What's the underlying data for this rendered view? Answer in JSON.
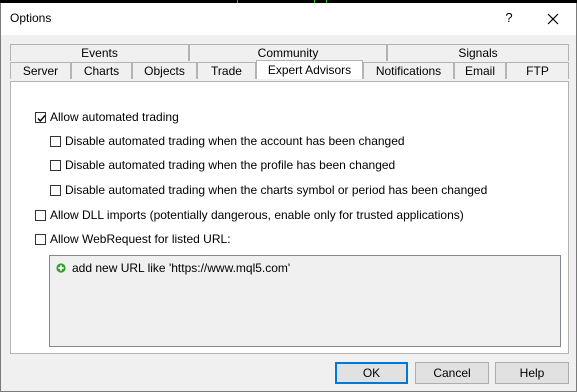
{
  "window": {
    "title": "Options",
    "help_label": "?"
  },
  "tabs_row1": [
    {
      "label": "Events"
    },
    {
      "label": "Community"
    },
    {
      "label": "Signals"
    }
  ],
  "tabs_row2": [
    {
      "label": "Server"
    },
    {
      "label": "Charts"
    },
    {
      "label": "Objects"
    },
    {
      "label": "Trade"
    },
    {
      "label": "Expert Advisors",
      "active": true
    },
    {
      "label": "Notifications"
    },
    {
      "label": "Email"
    },
    {
      "label": "FTP"
    }
  ],
  "options": {
    "allow_automated_trading": {
      "label": "Allow automated trading",
      "checked": true
    },
    "disable_on_account_change": {
      "label": "Disable automated trading when the account has been changed",
      "checked": false
    },
    "disable_on_profile_change": {
      "label": "Disable automated trading when the profile has been changed",
      "checked": false
    },
    "disable_on_symbol_change": {
      "label": "Disable automated trading when the charts symbol or period has been changed",
      "checked": false
    },
    "allow_dll_imports": {
      "label": "Allow DLL imports (potentially dangerous, enable only for trusted applications)",
      "checked": false
    },
    "allow_webrequest": {
      "label": "Allow WebRequest for listed URL:",
      "checked": false
    }
  },
  "url_list": {
    "add_item_label": "add new URL like 'https://www.mql5.com'",
    "add_icon": "plus-circle-icon",
    "add_icon_color": "#2e9e2e"
  },
  "buttons": {
    "ok": "OK",
    "cancel": "Cancel",
    "help": "Help"
  },
  "colors": {
    "dialog_bg": "#f0f0f0",
    "focus_border": "#0078d7"
  }
}
